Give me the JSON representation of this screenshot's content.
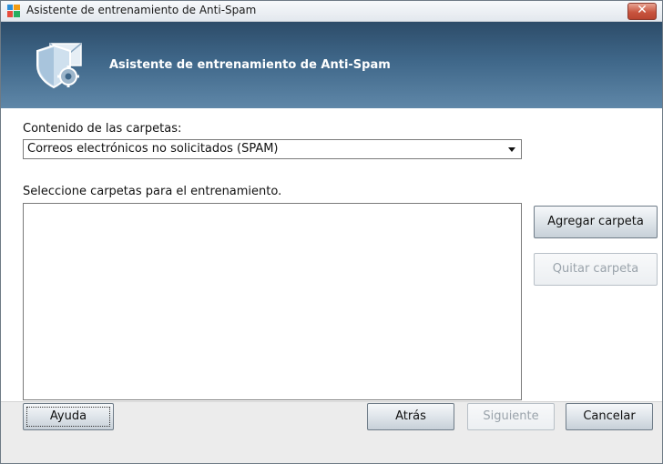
{
  "window": {
    "title": "Asistente de entrenamiento de Anti-Spam",
    "close_glyph": "✕"
  },
  "banner": {
    "title": "Asistente de entrenamiento de Anti-Spam",
    "icon": "shield-envelope-gear-icon"
  },
  "form": {
    "content_label": "Contenido de las carpetas:",
    "content_select_value": "Correos electrónicos no solicitados (SPAM)",
    "folders_label": "Seleccione carpetas para el entrenamiento.",
    "folders": []
  },
  "side_buttons": {
    "add_folder": "Agregar carpeta",
    "remove_folder": "Quitar carpeta"
  },
  "footer": {
    "help": "Ayuda",
    "back": "Atrás",
    "next": "Siguiente",
    "cancel": "Cancelar"
  },
  "colors": {
    "banner_dark": "#2d4c69",
    "banner_light": "#5f87a8",
    "close_red": "#c8553f"
  }
}
